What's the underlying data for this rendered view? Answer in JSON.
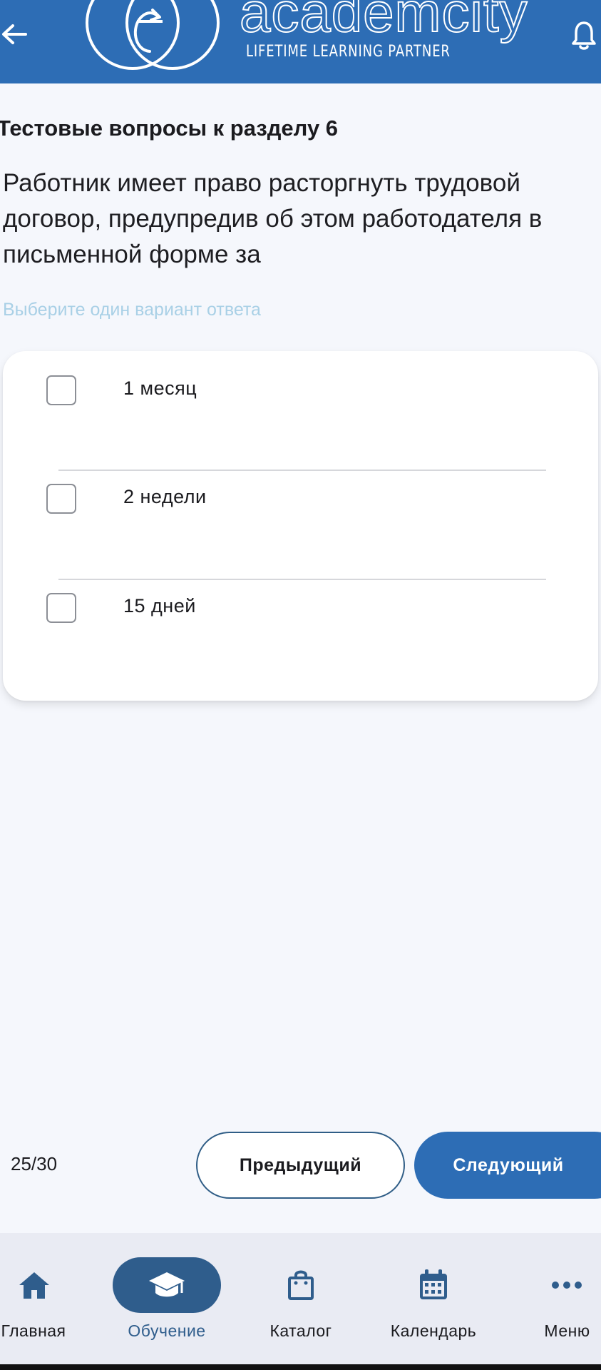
{
  "header": {
    "brand": "academcity",
    "tagline": "LIFETIME LEARNING PARTNER",
    "icons": {
      "back": "arrow-left-icon",
      "bell": "bell-icon",
      "logo": "academcity-logo-icon"
    },
    "background_color": "#2d6db5"
  },
  "quiz": {
    "section_title": "Тестовые вопросы к разделу 6",
    "question": "Работник имеет право расторгнуть трудовой договор, предупредив об этом работодателя в письменной форме за",
    "hint": "Выберите один вариант ответа",
    "options": [
      {
        "label": "1 месяц",
        "checked": false
      },
      {
        "label": "2 недели",
        "checked": false
      },
      {
        "label": "15 дней",
        "checked": false
      }
    ]
  },
  "navigation": {
    "progress": "25/30",
    "prev_label": "Предыдущий",
    "next_label": "Следующий",
    "accent_color": "#2d6db5"
  },
  "bottom_nav": {
    "items": [
      {
        "label": "Главная",
        "icon": "home-icon",
        "active": false
      },
      {
        "label": "Обучение",
        "icon": "graduation-cap-icon",
        "active": true
      },
      {
        "label": "Каталог",
        "icon": "shopping-bag-icon",
        "active": false
      },
      {
        "label": "Календарь",
        "icon": "calendar-icon",
        "active": false
      },
      {
        "label": "Меню",
        "icon": "more-horizontal-icon",
        "active": false
      }
    ],
    "active_color": "#2f5d8c"
  }
}
